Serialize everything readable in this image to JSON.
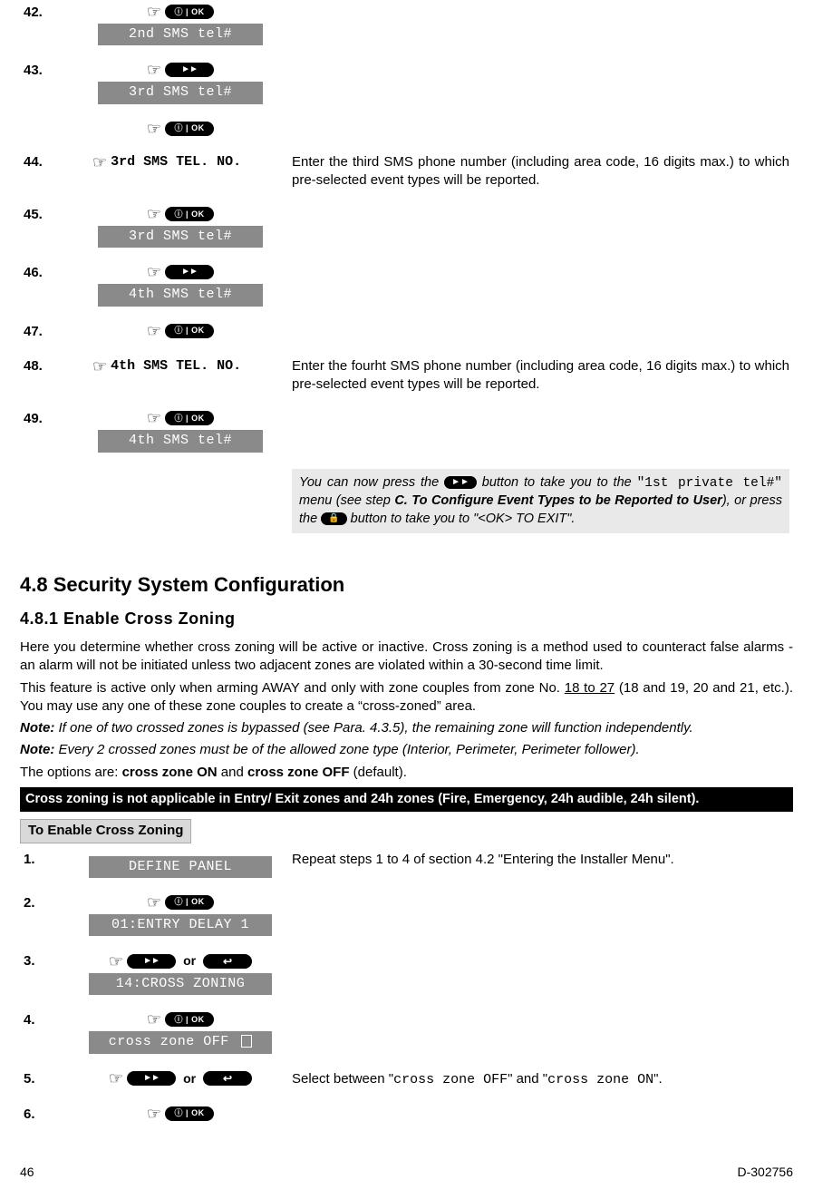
{
  "icons": {
    "hand": "☞",
    "iok_text": "ⓘ | OK",
    "forward": "►►",
    "back": "↩",
    "lock": "🔒"
  },
  "upper_steps": [
    {
      "num": "42.",
      "buttons": [
        "iok"
      ],
      "lcd": "2nd SMS tel#",
      "desc": ""
    },
    {
      "num": "43.",
      "buttons": [
        "ff"
      ],
      "lcd": "3rd SMS tel#",
      "desc": ""
    },
    {
      "num": "",
      "buttons": [
        "iok"
      ],
      "lcd": "",
      "desc": ""
    },
    {
      "num": "44.",
      "hand_label": "3rd SMS TEL. NO.",
      "desc": "Enter the third SMS phone number (including area code, 16 digits max.) to which pre-selected event types will be reported."
    },
    {
      "num": "45.",
      "buttons": [
        "iok"
      ],
      "lcd": "3rd SMS tel#",
      "desc": ""
    },
    {
      "num": "46.",
      "buttons": [
        "ff"
      ],
      "lcd": "4th SMS tel#",
      "desc": ""
    },
    {
      "num": "47.",
      "buttons": [
        "iok"
      ],
      "lcd": "",
      "desc": ""
    },
    {
      "num": "48.",
      "hand_label": "4th SMS TEL. NO.",
      "desc": "Enter the fourht SMS phone number (including area code, 16 digits max.) to which pre-selected event types will be reported."
    },
    {
      "num": "49.",
      "buttons": [
        "iok"
      ],
      "lcd": "4th SMS tel#",
      "desc": ""
    }
  ],
  "note": {
    "pre": "You can now press the ",
    "mid1": " button to take you to the ",
    "menu": "\"1st private tel#\"",
    "mid2": " menu (see step ",
    "bold": "C. To Configure Event Types to be Reported to User",
    "mid3": "), or press the ",
    "tail": " button to take you to \"<OK> TO EXIT\"."
  },
  "section": {
    "h2": "4.8 Security System Configuration",
    "h3": "4.8.1 Enable Cross Zoning",
    "p1": "Here you determine whether cross zoning will be active or inactive. Cross zoning is a method used to counteract false alarms - an alarm will not be initiated unless two adjacent zones are violated within a 30-second time limit.",
    "p2a": "This feature is active only when arming AWAY and only with zone couples from zone No. ",
    "p2u": "18 to 27",
    "p2b": " (18 and 19, 20 and 21, etc.). You may use any one of these zone couples to create a “cross-zoned” area.",
    "note1_lead": "Note:",
    "note1_body": " If one of two crossed zones is bypassed (see Para. 4.3.5), the remaining zone will function independently.",
    "note2_lead": "Note:",
    "note2_body": " Every 2 crossed zones must be of the allowed zone type (Interior, Perimeter, Perimeter follower).",
    "opts_lead": "The options are: ",
    "opt_on": "cross zone ON",
    "opts_mid": " and ",
    "opt_off": "cross zone OFF",
    "opts_tail": " (default).",
    "black": "Cross zoning is not applicable in Entry/ Exit zones and 24h zones (Fire, Emergency, 24h audible, 24h silent).",
    "proc_head": "To Enable Cross Zoning"
  },
  "lower_steps": [
    {
      "num": "1.",
      "lcd": "DEFINE PANEL",
      "desc": "Repeat steps 1 to 4 of section 4.2 \"Entering the Installer Menu\"."
    },
    {
      "num": "2.",
      "buttons": [
        "iok"
      ],
      "lcd": "01:ENTRY DELAY 1",
      "desc": ""
    },
    {
      "num": "3.",
      "buttons": [
        "ff",
        "or",
        "back"
      ],
      "lcd": "14:CROSS ZONING",
      "desc": ""
    },
    {
      "num": "4.",
      "buttons": [
        "iok"
      ],
      "lcd": "cross zone OFF ",
      "cursor": true,
      "desc": ""
    },
    {
      "num": "5.",
      "buttons": [
        "ff",
        "or",
        "back"
      ],
      "desc_pre": "Select between \"",
      "mono1": "cross zone OFF",
      "desc_mid": "\" and \"",
      "mono2": "cross zone ON",
      "desc_post": "\"."
    },
    {
      "num": "6.",
      "buttons": [
        "iok"
      ],
      "desc": ""
    }
  ],
  "footer": {
    "left": "46",
    "right": "D-302756"
  },
  "labels": {
    "or": "or"
  }
}
